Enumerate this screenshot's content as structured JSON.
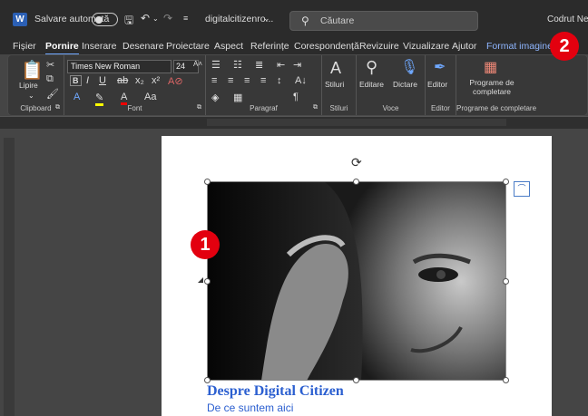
{
  "titlebar": {
    "app_logo": "W",
    "autosave_label": "Salvare automată",
    "document_name": "digitalcitizenro...",
    "search_placeholder": "Căutare",
    "user_name": "Codrut Neag"
  },
  "tabs": [
    {
      "label": "Fișier"
    },
    {
      "label": "Pornire"
    },
    {
      "label": "Inserare"
    },
    {
      "label": "Desenare"
    },
    {
      "label": "Proiectare"
    },
    {
      "label": "Aspect"
    },
    {
      "label": "Referințe"
    },
    {
      "label": "Corespondență"
    },
    {
      "label": "Revizuire"
    },
    {
      "label": "Vizualizare"
    },
    {
      "label": "Ajutor"
    },
    {
      "label": "Format imagine"
    }
  ],
  "ribbon": {
    "clipboard": {
      "paste": "Lipire",
      "group": "Clipboard"
    },
    "font": {
      "name": "Times New Roman",
      "size": "24",
      "group": "Font"
    },
    "paragraph": {
      "group": "Paragraf"
    },
    "styles": {
      "button": "Stiluri",
      "group": "Stiluri"
    },
    "voice": {
      "edit": "Editare",
      "dictate": "Dictare",
      "group": "Voce"
    },
    "editor": {
      "button": "Editor",
      "group": "Editor"
    },
    "addins": {
      "button_line1": "Programe de",
      "button_line2": "completare",
      "group": "Programe de completare"
    }
  },
  "document": {
    "heading": "Despre Digital Citizen",
    "subheading": "De ce suntem aici"
  },
  "annotations": {
    "marker1": "1",
    "marker2": "2"
  },
  "colors": {
    "accent": "#2b5fd0",
    "badge": "#e3000f"
  }
}
